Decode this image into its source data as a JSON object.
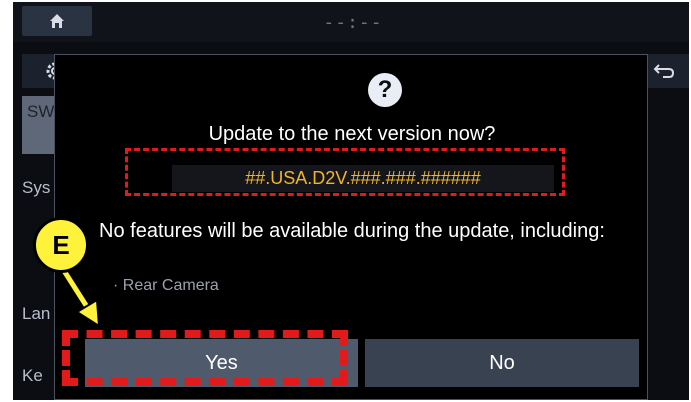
{
  "header": {
    "clock": "--:--"
  },
  "sidebar": {
    "items": [
      {
        "label": "SW Upd"
      },
      {
        "label": "Sys"
      },
      {
        "label": "Lan"
      },
      {
        "label": "Ke"
      }
    ]
  },
  "dialog": {
    "title": "Update to the next version now?",
    "version": "##.USA.D2V.###.###.######",
    "message": "No features will be available during the update, including:",
    "features": [
      "Rear Camera"
    ],
    "yes_label": "Yes",
    "no_label": "No"
  },
  "annotation": {
    "badge": "E"
  },
  "colors": {
    "highlight": "#e11b1b",
    "version_text": "#f2b428",
    "badge_fill": "#fff23a"
  }
}
